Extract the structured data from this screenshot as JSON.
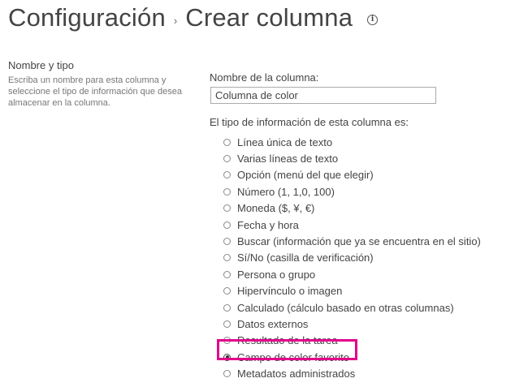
{
  "header": {
    "breadcrumb_parent": "Configuración",
    "breadcrumb_separator": "›",
    "title": "Crear columna",
    "info_icon": "info-icon"
  },
  "section": {
    "heading": "Nombre y tipo",
    "description": "Escriba un nombre para esta columna y seleccione el tipo de información que desea almacenar en la columna."
  },
  "form": {
    "name_label": "Nombre de la columna:",
    "name_value": "Columna de color",
    "type_label": "El tipo de información de esta columna es:",
    "types": [
      {
        "label": "Línea única de texto",
        "selected": false
      },
      {
        "label": "Varias líneas de texto",
        "selected": false
      },
      {
        "label": "Opción (menú del que elegir)",
        "selected": false
      },
      {
        "label": "Número (1, 1,0, 100)",
        "selected": false
      },
      {
        "label": "Moneda ($, ¥, €)",
        "selected": false
      },
      {
        "label": "Fecha y hora",
        "selected": false
      },
      {
        "label": "Buscar (información que ya se encuentra en el sitio)",
        "selected": false
      },
      {
        "label": "Sí/No (casilla de verificación)",
        "selected": false
      },
      {
        "label": "Persona o grupo",
        "selected": false
      },
      {
        "label": "Hipervínculo o imagen",
        "selected": false
      },
      {
        "label": "Calculado (cálculo basado en otras columnas)",
        "selected": false
      },
      {
        "label": "Datos externos",
        "selected": false
      },
      {
        "label": "Resultado de la tarea",
        "selected": false
      },
      {
        "label": "Campo de color favorito",
        "selected": true
      },
      {
        "label": "Metadatos administrados",
        "selected": false
      }
    ]
  },
  "colors": {
    "highlight": "#e3008c",
    "text": "#444444"
  }
}
